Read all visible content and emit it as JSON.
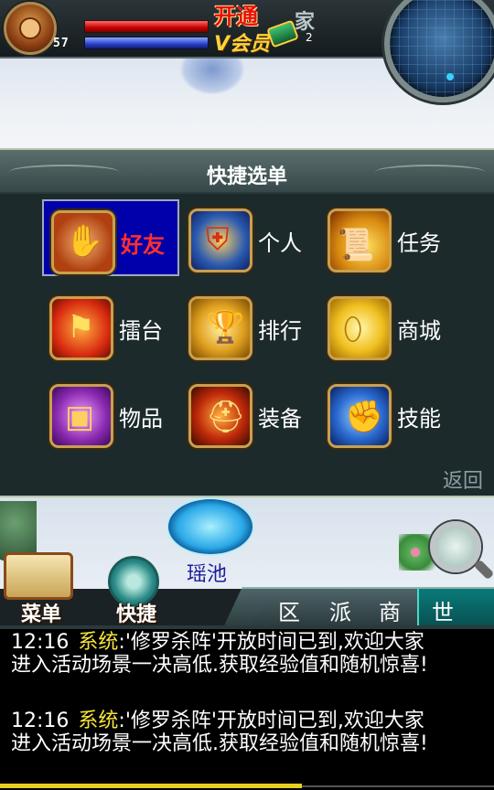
{
  "hud": {
    "level": "57",
    "vip_line1": "开通",
    "vip_line2": "V会员",
    "family_label": "家",
    "family_count": "2",
    "hp_color": "#c40000",
    "mp_color": "#2a40c8"
  },
  "quick_menu": {
    "title": "快捷选单",
    "items": [
      {
        "label": "好友",
        "icon": "handshake-icon",
        "selected": true
      },
      {
        "label": "个人",
        "icon": "armor-icon"
      },
      {
        "label": "任务",
        "icon": "scroll-gold-icon"
      },
      {
        "label": "擂台",
        "icon": "flag-icon"
      },
      {
        "label": "排行",
        "icon": "trophy-icon"
      },
      {
        "label": "商城",
        "icon": "gold-ingot-icon"
      },
      {
        "label": "物品",
        "icon": "treasure-chest-icon"
      },
      {
        "label": "装备",
        "icon": "helmet-icon"
      },
      {
        "label": "技能",
        "icon": "fist-icon"
      }
    ],
    "back_label": "返回"
  },
  "scene": {
    "portal_label": "瑶池"
  },
  "bottom_bar": {
    "menu_label": "菜单",
    "quick_label": "快捷",
    "tabs": [
      "区",
      "派",
      "商",
      "世"
    ],
    "active_tab": "世"
  },
  "chat": {
    "messages": [
      {
        "time": "12:16",
        "channel": "系统",
        "text": ":'修罗杀阵'开放时间已到,欢迎大家进入活动场景一决高低.获取经验值和随机惊喜!"
      },
      {
        "time": "12:16",
        "channel": "系统",
        "text": ":'修罗杀阵'开放时间已到,欢迎大家进入活动场景一决高低.获取经验值和随机惊喜!"
      }
    ]
  },
  "colors": {
    "chat_channel": "#f5e63a",
    "selected_item_bg": "#0000aa",
    "selected_item_text": "#ff3030",
    "portal_label": "#1b1b9a"
  }
}
